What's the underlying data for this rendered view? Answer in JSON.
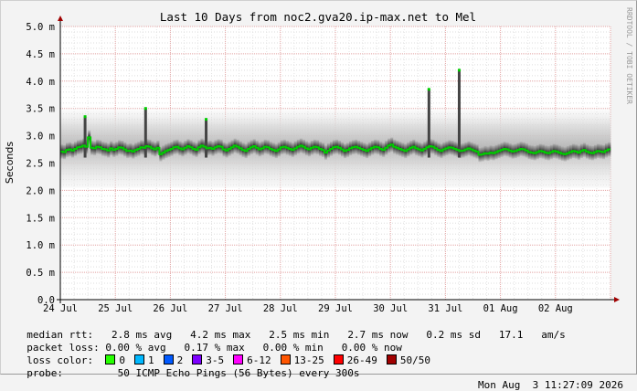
{
  "chart_data": {
    "type": "line",
    "title": "Last 10 Days from noc2.gva20.ip-max.net to Mel",
    "ylabel": "Seconds",
    "watermark": "RRDTOOL / TOBI OETIKER",
    "ylim": [
      0,
      5.0
    ],
    "yticks": [
      "0.0",
      "0.5 m",
      "1.0 m",
      "1.5 m",
      "2.0 m",
      "2.5 m",
      "3.0 m",
      "3.5 m",
      "4.0 m",
      "4.5 m",
      "5.0 m"
    ],
    "xticks": [
      "24 Jul",
      "25 Jul",
      "26 Jul",
      "27 Jul",
      "28 Jul",
      "29 Jul",
      "30 Jul",
      "31 Jul",
      "01 Aug",
      "02 Aug"
    ],
    "x_days": [
      0,
      10
    ],
    "series": [
      {
        "name": "median rtt",
        "color": "#00cc00",
        "values": [
          2.71,
          2.7,
          2.74,
          2.75,
          2.73,
          2.76,
          2.79,
          2.8,
          2.82,
          2.8,
          2.97,
          2.78,
          2.77,
          2.8,
          2.79,
          2.76,
          2.75,
          2.73,
          2.77,
          2.74,
          2.76,
          2.79,
          2.78,
          2.75,
          2.72,
          2.73,
          2.71,
          2.74,
          2.76,
          2.79,
          2.78,
          2.81,
          2.8,
          2.77,
          2.75,
          2.78,
          2.66,
          2.69,
          2.72,
          2.74,
          2.76,
          2.79,
          2.8,
          2.77,
          2.75,
          2.78,
          2.81,
          2.79,
          2.76,
          2.74,
          2.79,
          2.82,
          2.8,
          2.77,
          2.78,
          2.76,
          2.79,
          2.81,
          2.8,
          2.75,
          2.73,
          2.76,
          2.79,
          2.82,
          2.8,
          2.77,
          2.74,
          2.72,
          2.76,
          2.79,
          2.81,
          2.78,
          2.75,
          2.77,
          2.8,
          2.79,
          2.76,
          2.74,
          2.72,
          2.75,
          2.79,
          2.8,
          2.78,
          2.76,
          2.74,
          2.77,
          2.8,
          2.82,
          2.8,
          2.77,
          2.75,
          2.78,
          2.8,
          2.79,
          2.76,
          2.74,
          2.69,
          2.73,
          2.76,
          2.79,
          2.8,
          2.78,
          2.75,
          2.72,
          2.74,
          2.77,
          2.79,
          2.8,
          2.78,
          2.76,
          2.74,
          2.72,
          2.75,
          2.78,
          2.8,
          2.79,
          2.76,
          2.74,
          2.78,
          2.82,
          2.84,
          2.8,
          2.78,
          2.76,
          2.74,
          2.72,
          2.75,
          2.78,
          2.8,
          2.77,
          2.75,
          2.73,
          2.76,
          2.79,
          2.81,
          2.8,
          2.77,
          2.74,
          2.72,
          2.75,
          2.77,
          2.79,
          2.78,
          2.76,
          2.74,
          2.72,
          2.73,
          2.75,
          2.77,
          2.75,
          2.73,
          2.71,
          2.65,
          2.66,
          2.68,
          2.67,
          2.69,
          2.68,
          2.7,
          2.72,
          2.74,
          2.76,
          2.75,
          2.73,
          2.71,
          2.72,
          2.74,
          2.76,
          2.75,
          2.73,
          2.7,
          2.69,
          2.68,
          2.7,
          2.72,
          2.71,
          2.69,
          2.68,
          2.7,
          2.72,
          2.71,
          2.69,
          2.67,
          2.66,
          2.68,
          2.7,
          2.72,
          2.71,
          2.69,
          2.72,
          2.74,
          2.71,
          2.69,
          2.68,
          2.7,
          2.72,
          2.71,
          2.7,
          2.73,
          2.75
        ]
      }
    ],
    "spikes": [
      {
        "day": 0.45,
        "top": 3.35
      },
      {
        "day": 1.55,
        "top": 3.5
      },
      {
        "day": 2.65,
        "top": 3.3
      },
      {
        "day": 6.7,
        "top": 3.85
      },
      {
        "day": 7.25,
        "top": 4.2
      }
    ]
  },
  "legend": {
    "median_rtt": {
      "label": "median rtt:",
      "avg": "2.8 ms avg",
      "max": "4.2 ms max",
      "min": "2.5 ms min",
      "now": "2.7 ms now",
      "sd": "0.2 ms sd",
      "am": "17.1",
      "am_unit": "am/s"
    },
    "packet_loss": {
      "label": "packet loss:",
      "avg": "0.00 % avg",
      "max": "0.17 % max",
      "min": "0.00 % min",
      "now": "0.00 % now"
    },
    "loss_color": {
      "label": "loss color:",
      "items": [
        {
          "label": "0",
          "color": "#26ff00"
        },
        {
          "label": "1",
          "color": "#00b8ff"
        },
        {
          "label": "2",
          "color": "#0059ff"
        },
        {
          "label": "3-5",
          "color": "#7e00ff"
        },
        {
          "label": "6-12",
          "color": "#ff00ff"
        },
        {
          "label": "13-25",
          "color": "#ff5500"
        },
        {
          "label": "26-49",
          "color": "#ff0000"
        },
        {
          "label": "50/50",
          "color": "#a10000"
        }
      ]
    },
    "probe": {
      "label": "probe:",
      "text": "50 ICMP Echo Pings (56 Bytes) every 300s",
      "timestamp": "Mon Aug  3 11:27:09 2026"
    }
  }
}
